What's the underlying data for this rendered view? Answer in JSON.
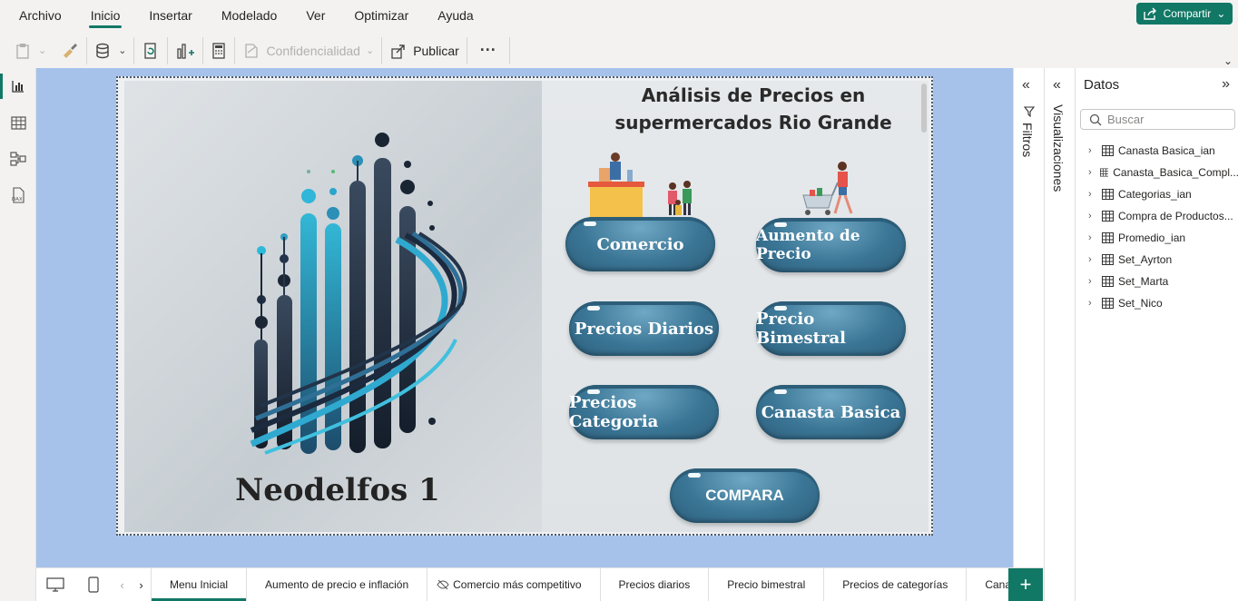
{
  "menu": {
    "items": [
      "Archivo",
      "Inicio",
      "Insertar",
      "Modelado",
      "Ver",
      "Optimizar",
      "Ayuda"
    ],
    "active": "Inicio",
    "share_label": "Compartir"
  },
  "ribbon": {
    "confidencialidad_label": "Confidencialidad",
    "publicar_label": "Publicar",
    "more_label": "···"
  },
  "report": {
    "title_line1": "Análisis de Precios en",
    "title_line2": "supermercados Rio Grande",
    "brand": "Neodelfos 1",
    "buttons": {
      "comercio": "Comercio",
      "aumento": "Aumento de Precio",
      "diarios": "Precios Diarios",
      "bimestral": "Precio Bimestral",
      "categoria": "Precios Categoria",
      "canasta": "Canasta Basica",
      "compara": "COMPARA"
    }
  },
  "panes": {
    "filters_label": "Filtros",
    "visualizations_label": "Visualizaciones",
    "data_title": "Datos",
    "search_placeholder": "Buscar",
    "tables": [
      "Canasta Basica_ian",
      "Canasta_Basica_Compl...",
      "Categorias_ian",
      "Compra de Productos...",
      "Promedio_ian",
      "Set_Ayrton",
      "Set_Marta",
      "Set_Nico"
    ]
  },
  "tabs": {
    "pages": [
      "Menu Inicial",
      "Aumento de precio e inflación",
      "Comercio más competitivo",
      "Precios diarios",
      "Precio bimestral",
      "Precios de categorías",
      "Canast"
    ],
    "active": "Menu Inicial",
    "add_label": "+"
  },
  "colors": {
    "accent": "#117865",
    "canvas_bg": "#a6c2ea",
    "pill": "#3b7696"
  }
}
